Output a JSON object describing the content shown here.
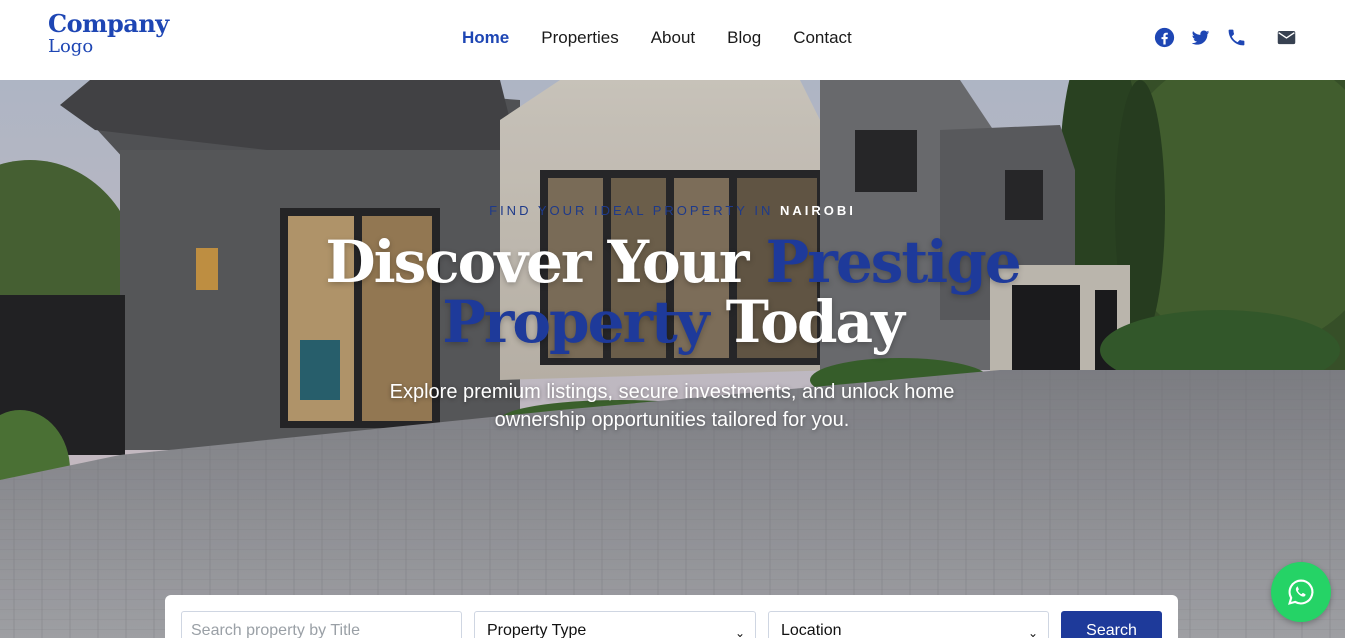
{
  "logo": {
    "line1": "Company",
    "line2": "Logo"
  },
  "nav": [
    {
      "label": "Home",
      "active": true
    },
    {
      "label": "Properties"
    },
    {
      "label": "About"
    },
    {
      "label": "Blog"
    },
    {
      "label": "Contact"
    }
  ],
  "social": [
    "facebook-icon",
    "twitter-icon",
    "phone-icon",
    "envelope-icon"
  ],
  "colors": {
    "brand": "#1e46b4",
    "accent": "#1e3a9a",
    "whatsapp": "#25d366"
  },
  "hero": {
    "eyebrow_prefix": "FIND YOUR IDEAL PROPERTY IN",
    "eyebrow_city": "NAIROBI",
    "title_white_1": "Discover Your",
    "title_accent": "Prestige Property",
    "title_white_2": "Today",
    "subtitle": "Explore premium listings, secure investments, and unlock home ownership opportunities tailored for you."
  },
  "search": {
    "placeholder": "Search property by Title",
    "property_type": "Property Type",
    "location": "Location",
    "button": "Search"
  }
}
